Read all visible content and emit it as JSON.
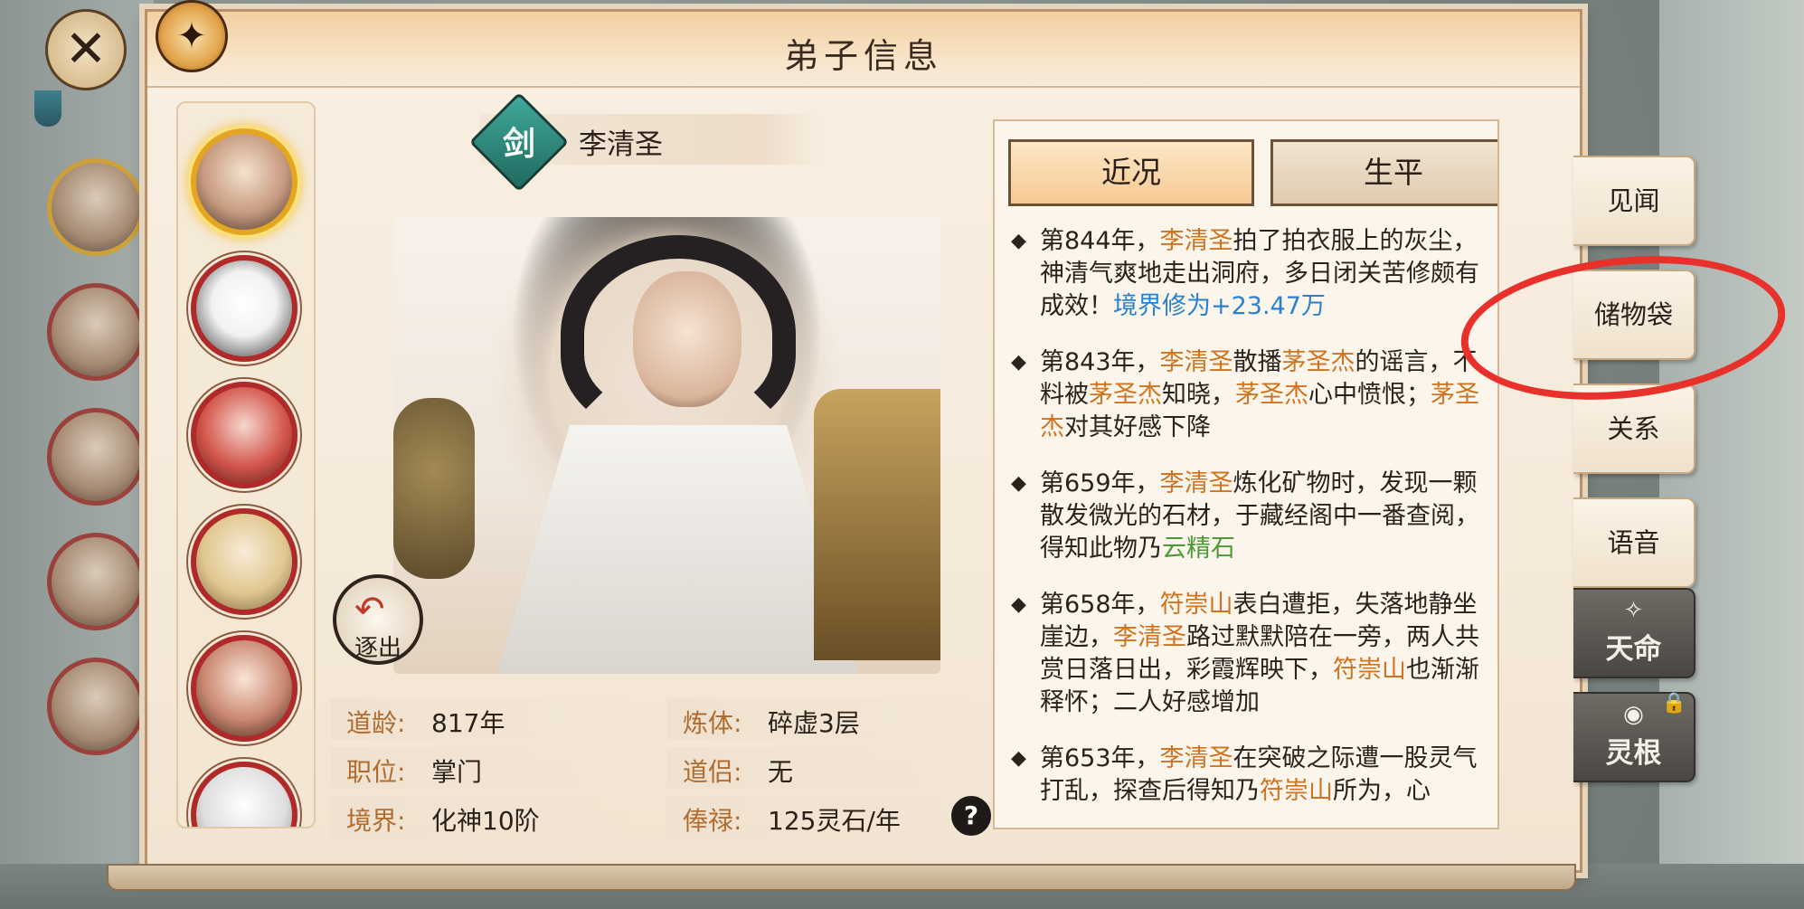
{
  "window": {
    "title": "弟子信息"
  },
  "disciple": {
    "name": "李清圣",
    "weapon_badge": "剑",
    "expel_label": "逐出",
    "stats": [
      {
        "label": "道龄:",
        "value": "817年"
      },
      {
        "label": "炼体:",
        "value": "碎虚3层"
      },
      {
        "label": "职位:",
        "value": "掌门"
      },
      {
        "label": "道侣:",
        "value": "无"
      },
      {
        "label": "境界:",
        "value": "化神10阶"
      },
      {
        "label": "俸禄:",
        "value": "125灵石/年"
      }
    ],
    "help_label": "?"
  },
  "tabs": {
    "active": "近况",
    "inactive": "生平"
  },
  "log": [
    {
      "parts": [
        {
          "t": "第844年，",
          "c": ""
        },
        {
          "t": "李清圣",
          "c": "hl-name"
        },
        {
          "t": "拍了拍衣服上的灰尘，神清气爽地走出洞府，多日闭关苦修颇有成效！",
          "c": ""
        },
        {
          "t": "境界修为+23.47万",
          "c": "hl-blue"
        }
      ]
    },
    {
      "parts": [
        {
          "t": "第843年，",
          "c": ""
        },
        {
          "t": "李清圣",
          "c": "hl-name"
        },
        {
          "t": "散播",
          "c": ""
        },
        {
          "t": "茅圣杰",
          "c": "hl-name"
        },
        {
          "t": "的谣言，不料被",
          "c": ""
        },
        {
          "t": "茅圣杰",
          "c": "hl-name"
        },
        {
          "t": "知晓，",
          "c": ""
        },
        {
          "t": "茅圣杰",
          "c": "hl-name"
        },
        {
          "t": "心中愤恨；",
          "c": ""
        },
        {
          "t": "茅圣杰",
          "c": "hl-name"
        },
        {
          "t": "对其好感下降",
          "c": ""
        }
      ]
    },
    {
      "parts": [
        {
          "t": "第659年，",
          "c": ""
        },
        {
          "t": "李清圣",
          "c": "hl-name"
        },
        {
          "t": "炼化矿物时，发现一颗散发微光的石材，于藏经阁中一番查阅，得知此物乃",
          "c": ""
        },
        {
          "t": "云精石",
          "c": "hl-green"
        }
      ]
    },
    {
      "parts": [
        {
          "t": "第658年，",
          "c": ""
        },
        {
          "t": "符崇山",
          "c": "hl-name"
        },
        {
          "t": "表白遭拒，失落地静坐崖边，",
          "c": ""
        },
        {
          "t": "李清圣",
          "c": "hl-name"
        },
        {
          "t": "路过默默陪在一旁，两人共赏日落日出，彩霞辉映下，",
          "c": ""
        },
        {
          "t": "符崇山",
          "c": "hl-name"
        },
        {
          "t": "也渐渐释怀；二人好感增加",
          "c": ""
        }
      ]
    },
    {
      "parts": [
        {
          "t": "第653年，",
          "c": ""
        },
        {
          "t": "李清圣",
          "c": "hl-name"
        },
        {
          "t": "在突破之际遭一股灵气打乱，探查后得知乃",
          "c": ""
        },
        {
          "t": "符崇山",
          "c": "hl-name"
        },
        {
          "t": "所为，心",
          "c": ""
        }
      ]
    }
  ],
  "side_tabs": {
    "jianwen": "见闻",
    "chuwudai": "储物袋",
    "guanxi": "关系",
    "yuyin": "语音",
    "tianming": "天命",
    "linggen": "灵根"
  },
  "colors": {
    "accent_orange": "#d0731f",
    "accent_blue": "#2a82cf",
    "accent_green": "#4b9a36",
    "annotation_red": "#e7312a"
  }
}
